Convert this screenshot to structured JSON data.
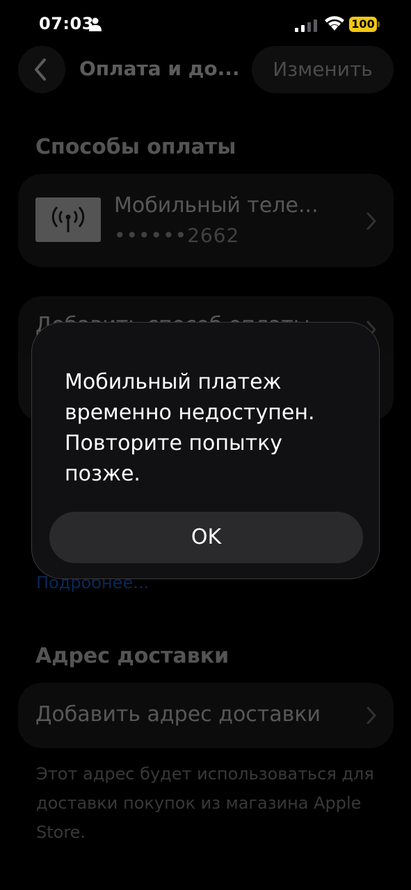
{
  "status_bar": {
    "time": "07:03",
    "battery": "100",
    "icons": [
      "person-icon",
      "cellular-signal-icon",
      "wifi-icon",
      "battery-icon"
    ]
  },
  "nav": {
    "back_icon": "chevron-left-icon",
    "title": "Оплата и до...",
    "edit_label": "Изменить"
  },
  "payment_section": {
    "header": "Способы оплаты",
    "method": {
      "icon": "cellular-antenna-icon",
      "name": "Мобильный теле...",
      "number": "••••••2662"
    },
    "add_label": "Добавить способ оплаты",
    "more_link": "Подробнее..."
  },
  "shipping_section": {
    "header": "Адрес доставки",
    "add_label": "Добавить адрес доставки",
    "footnote": "Этот адрес будет использоваться для доставки покупок из магазина Apple Store."
  },
  "alert": {
    "message": "Мобильный платеж временно недоступен. Повторите попытку позже.",
    "ok_label": "OK"
  },
  "colors": {
    "background": "#000000",
    "card": "#232325",
    "link": "#1e6ff0",
    "battery": "#f2c715"
  }
}
